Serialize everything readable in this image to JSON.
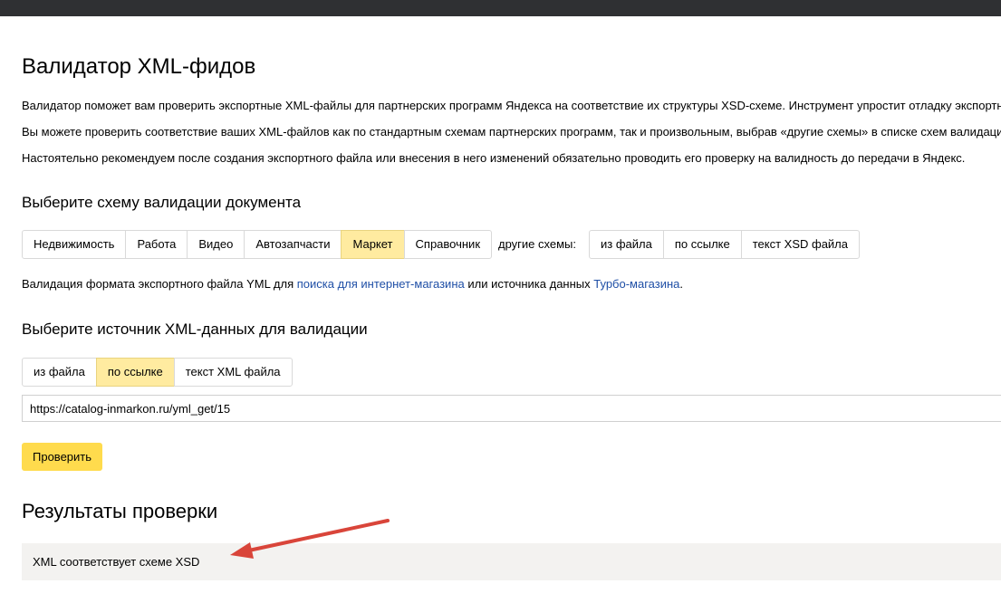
{
  "page": {
    "title": "Валидатор XML-фидов",
    "intro": [
      "Валидатор поможет вам проверить экспортные XML-файлы для партнерских программ Яндекса на соответствие их структуры XSD-схеме. Инструмент упростит отладку экспортных",
      "Вы можете проверить соответствие ваших XML-файлов как по стандартным схемам партнерских программ, так и произвольным, выбрав «другие схемы» в списке схем валидации",
      "Настоятельно рекомендуем после создания экспортного файла или внесения в него изменений обязательно проводить его проверку на валидность до передачи в Яндекс."
    ]
  },
  "schema": {
    "heading": "Выберите схему валидации документа",
    "options": [
      "Недвижимость",
      "Работа",
      "Видео",
      "Автозапчасти",
      "Маркет",
      "Справочник"
    ],
    "selected": "Маркет",
    "other_label": "другие схемы:",
    "other_options": [
      "из файла",
      "по ссылке",
      "текст XSD файла"
    ],
    "note": {
      "prefix": "Валидация формата экспортного файла YML для ",
      "link1": "поиска для интернет-магазина",
      "middle": " или источника данных ",
      "link2": "Турбо-магазина",
      "suffix": "."
    }
  },
  "source": {
    "heading": "Выберите источник XML-данных для валидации",
    "options": [
      "из файла",
      "по ссылке",
      "текст XML файла"
    ],
    "selected": "по ссылке",
    "url_value": "https://catalog-inmarkon.ru/yml_get/15",
    "check_label": "Проверить"
  },
  "results": {
    "heading": "Результаты проверки",
    "message": "XML соответствует схеме XSD"
  },
  "colors": {
    "active_tab": "#ffeba0",
    "primary_button": "#ffdb4d",
    "link": "#1f4fa6",
    "annotation_arrow": "#d9453a",
    "top_bar": "#2f3033"
  }
}
